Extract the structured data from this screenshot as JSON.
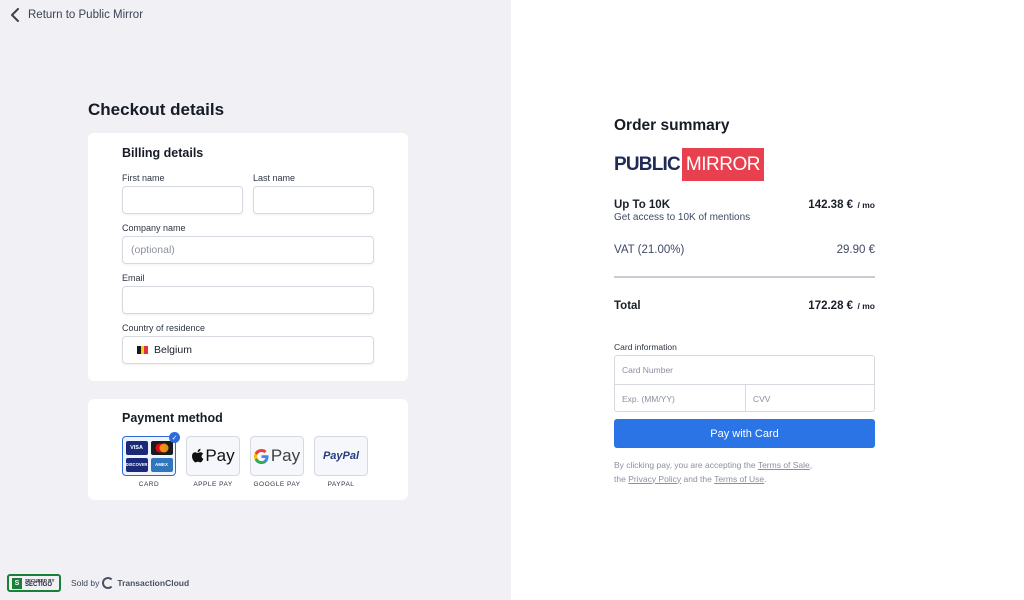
{
  "nav": {
    "back_label": "Return to Public Mirror"
  },
  "checkout": {
    "title": "Checkout details",
    "billing": {
      "title": "Billing details",
      "first_name_label": "First name",
      "first_name_value": "",
      "last_name_label": "Last name",
      "last_name_value": "",
      "company_label": "Company name",
      "company_placeholder": "(optional)",
      "email_label": "Email",
      "email_value": "",
      "country_label": "Country of residence",
      "country_value": "Belgium"
    },
    "payment": {
      "title": "Payment method",
      "options": [
        {
          "label": "CARD",
          "selected": true
        },
        {
          "label": "APPLE PAY",
          "selected": false
        },
        {
          "label": "GOOGLE PAY",
          "selected": false
        },
        {
          "label": "PAYPAL",
          "selected": false
        }
      ],
      "card_brands": [
        "VISA",
        "DISCOVER",
        "AMEX"
      ],
      "apple_pay_mark": "Pay",
      "google_pay_mark": "Pay",
      "paypal_mark": "PayPal"
    }
  },
  "footer": {
    "badge_line1": "SECURED BY",
    "badge_line2": "SECTIGO",
    "sold_by": "Sold by",
    "seller": "TransactionCloud"
  },
  "summary": {
    "title": "Order summary",
    "brand_part1": "PUBLIC",
    "brand_part2": "MIRROR",
    "plan_name": "Up To 10K",
    "plan_price": "142.38 €",
    "per_month": "/ mo",
    "plan_desc": "Get access to 10K of mentions",
    "vat_label": "VAT (21.00%)",
    "vat_value": "29.90 €",
    "total_label": "Total",
    "total_value": "172.28 €",
    "card_info_label": "Card information",
    "card_number_placeholder": "Card Number",
    "expiry_placeholder": "Exp. (MM/YY)",
    "cvv_placeholder": "CVV",
    "pay_button": "Pay with Card",
    "legal_text1": "By clicking pay, you are accepting the",
    "terms_of_sale": "Terms of Sale",
    "legal_text2": "the",
    "privacy_policy": "Privacy Policy",
    "legal_text3": "and the",
    "terms_of_use": "Terms of Use"
  },
  "colors": {
    "accent": "#2a74e6",
    "brand_red": "#e8404f",
    "brand_navy": "#1f2a57",
    "panel_bg": "#f1f1f5"
  }
}
